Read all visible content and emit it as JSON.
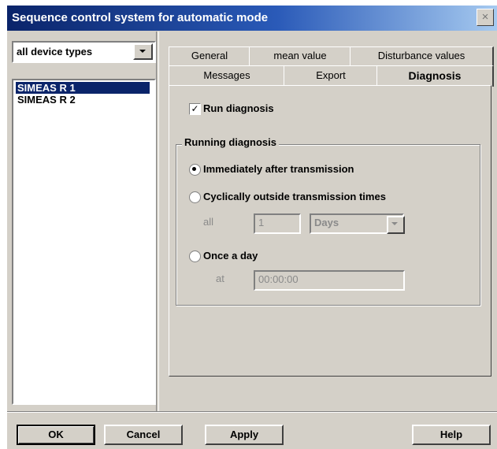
{
  "window": {
    "title": "Sequence control system for automatic mode",
    "close_label": "×"
  },
  "sidebar": {
    "device_type_value": "all device types",
    "devices": [
      "SIMEAS R 1",
      "SIMEAS R 2"
    ],
    "selected_index": 0
  },
  "tabs": {
    "row1": [
      "General",
      "mean value",
      "Disturbance values"
    ],
    "row2": [
      "Messages",
      "Export",
      "Diagnosis"
    ],
    "active": "Diagnosis"
  },
  "diagnosis": {
    "run_label": "Run diagnosis",
    "run_checked": true,
    "group_title": "Running diagnosis",
    "option_immediate": "Immediately after transmission",
    "option_cyclic": "Cyclically outside transmission times",
    "option_daily": "Once a day",
    "selected_option": "immediate",
    "all_label": "all",
    "interval_value": "1",
    "interval_unit": "Days",
    "at_label": "at",
    "time_value": "00:00:00"
  },
  "buttons": {
    "ok": "OK",
    "cancel": "Cancel",
    "apply": "Apply",
    "help": "Help"
  }
}
